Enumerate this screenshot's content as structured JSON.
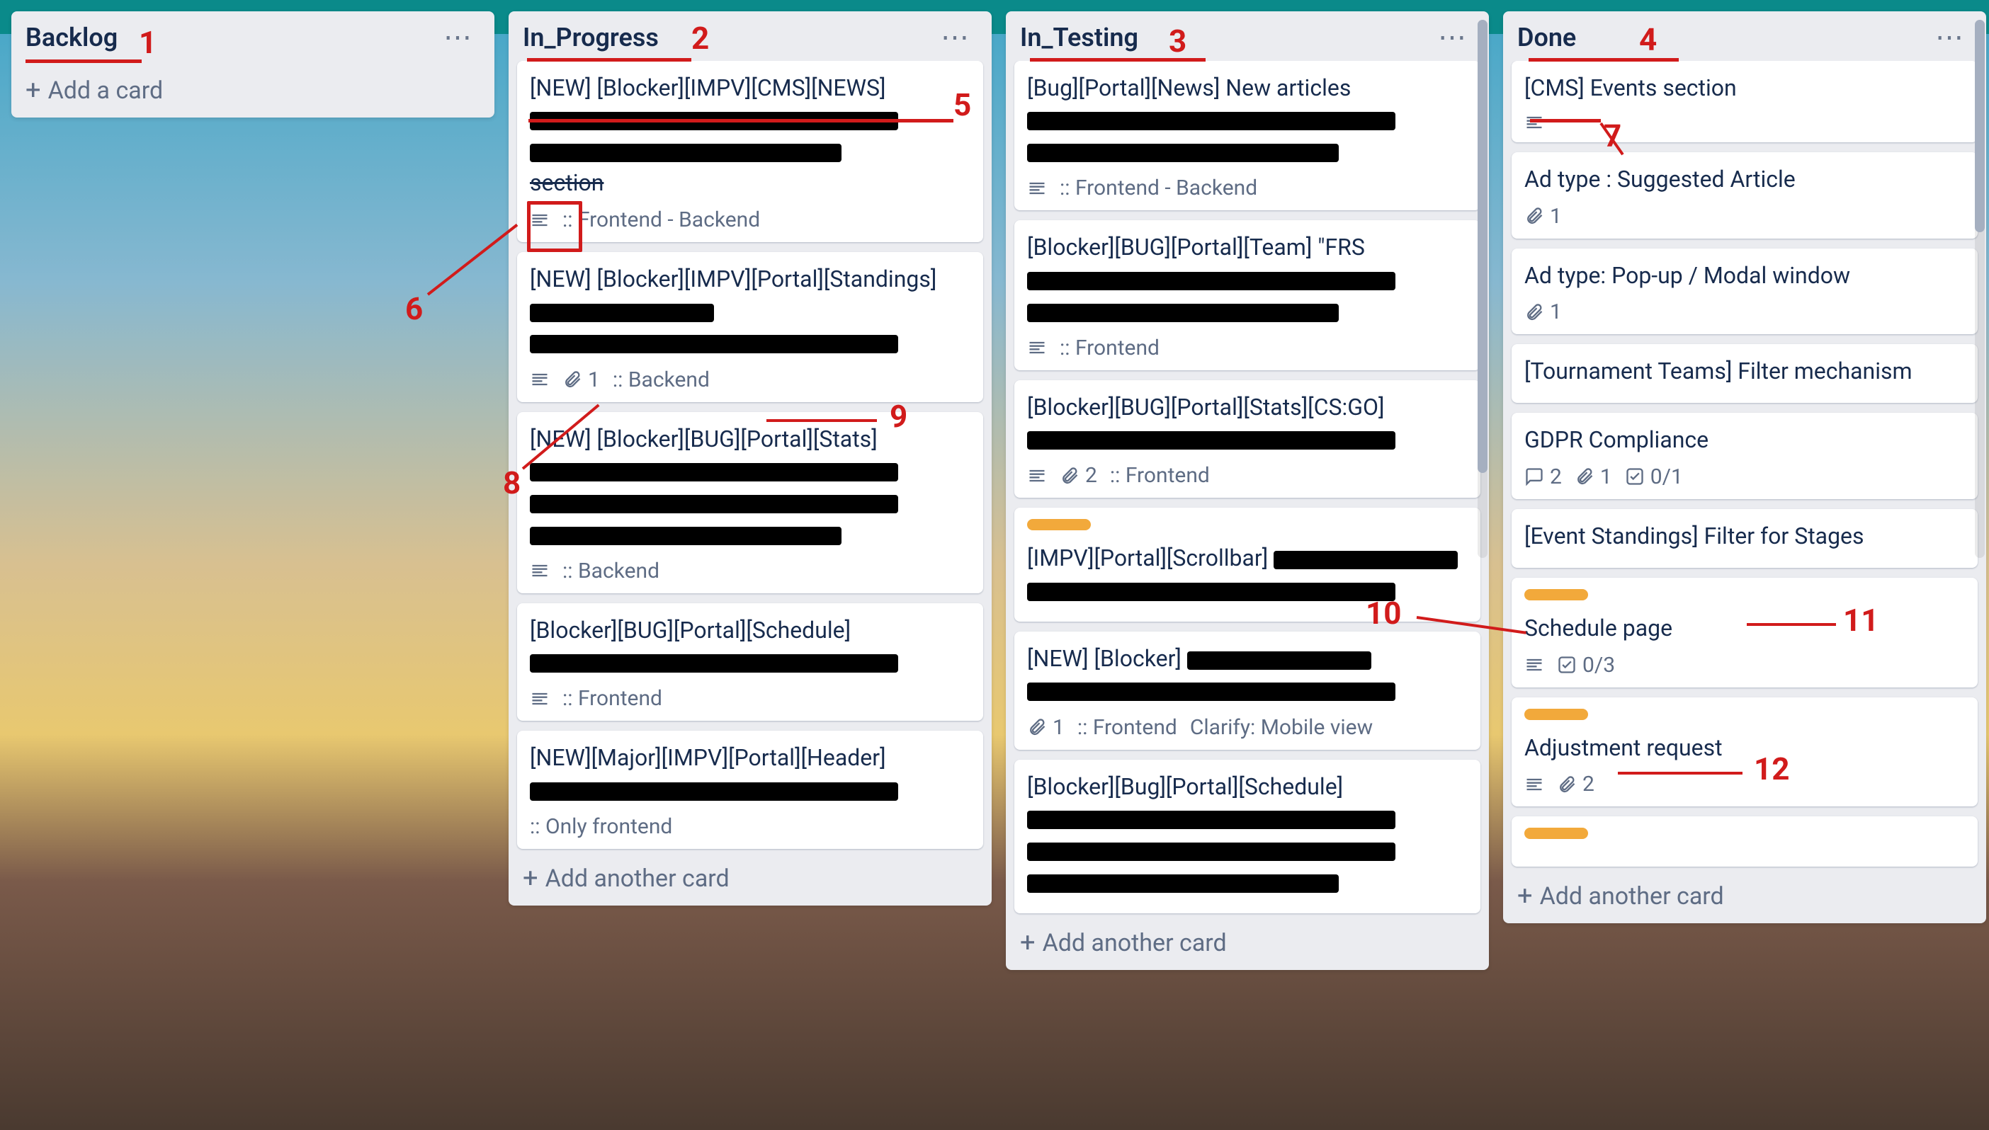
{
  "lists": [
    {
      "title": "Backlog",
      "add_label": "Add a card",
      "cards": []
    },
    {
      "title": "In_Progress",
      "add_label": "Add another card",
      "cards": [
        {
          "title": "[NEW] [Blocker][IMPV][CMS][NEWS]",
          "redact_lines": 2,
          "strike_suffix": "section",
          "desc": true,
          "meta": ":: Frontend - Backend"
        },
        {
          "title": "[NEW] [Blocker][IMPV][Portal][Standings]",
          "redact_inline": true,
          "redact_lines": 1,
          "desc": true,
          "attach": "1",
          "meta": ":: Backend"
        },
        {
          "title": "[NEW] [Blocker][BUG][Portal][Stats]",
          "redact_lines": 3,
          "desc": true,
          "meta": ":: Backend"
        },
        {
          "title": "[Blocker][BUG][Portal][Schedule]",
          "redact_lines": 1,
          "desc": true,
          "meta": ":: Frontend"
        },
        {
          "title": "[NEW][Major][IMPV][Portal][Header]",
          "redact_lines": 1,
          "meta": ":: Only frontend"
        }
      ]
    },
    {
      "title": "In_Testing",
      "add_label": "Add another card",
      "cards": [
        {
          "title": "[Bug][Portal][News] New articles",
          "redact_lines": 2,
          "desc": true,
          "meta": ":: Frontend - Backend"
        },
        {
          "title": "[Blocker][BUG][Portal][Team] \"FRS",
          "redact_lines": 2,
          "desc": true,
          "meta": ":: Frontend"
        },
        {
          "title": "[Blocker][BUG][Portal][Stats][CS:GO]",
          "redact_lines": 1,
          "desc": true,
          "attach": "2",
          "meta": ":: Frontend"
        },
        {
          "label": "yellow",
          "title": "[IMPV][Portal][Scrollbar]",
          "redact_inline": true,
          "redact_lines": 1
        },
        {
          "title": "[NEW] [Blocker]",
          "redact_inline": true,
          "redact_lines": 1,
          "attach": "1",
          "meta": ":: Frontend",
          "meta2": "Clarify: Mobile view"
        },
        {
          "title": "[Blocker][Bug][Portal][Schedule]",
          "redact_lines": 3
        }
      ]
    },
    {
      "title": "Done",
      "add_label": "Add another card",
      "cards": [
        {
          "title": "[CMS] Events section",
          "desc": true
        },
        {
          "title": "Ad type : Suggested Article",
          "attach": "1"
        },
        {
          "title": "Ad type: Pop-up / Modal window",
          "attach": "1"
        },
        {
          "title": "[Tournament Teams] Filter mechanism"
        },
        {
          "title": "GDPR Compliance",
          "comments": "2",
          "attach": "1",
          "checklist": "0/1"
        },
        {
          "title": "[Event Standings] Filter for Stages"
        },
        {
          "label": "yellow",
          "title": "Schedule page",
          "desc": true,
          "checklist": "0/3"
        },
        {
          "label": "yellow",
          "title": "Adjustment request",
          "desc": true,
          "attach": "2"
        },
        {
          "label": "yellow",
          "title": ""
        }
      ]
    }
  ],
  "annotations": {
    "1": "1",
    "2": "2",
    "3": "3",
    "4": "4",
    "5": "5",
    "6": "6",
    "7": "7",
    "8": "8",
    "9": "9",
    "10": "10",
    "11": "11",
    "12": "12"
  }
}
